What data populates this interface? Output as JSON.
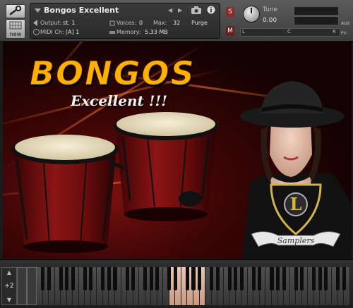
{
  "instrument": {
    "name": "Bongos Excellent",
    "output_label": "Output:",
    "output_value": "st. 1",
    "voices_label": "Voices:",
    "voices_value": "0",
    "max_label": "Max:",
    "max_value": "32",
    "purge_label": "Purge",
    "midi_label": "MIDI Ch:",
    "midi_value": "[A]  1",
    "memory_label": "Memory:",
    "memory_value": "5.33 MB"
  },
  "controls": {
    "solo_label": "S",
    "mute_label": "M",
    "tune_label": "Tune",
    "tune_value": "0.00",
    "aux_label": "AUX",
    "pv_label": "PV",
    "pan_left_label": "L",
    "pan_center_label": "C",
    "pan_right_label": "R"
  },
  "artwork": {
    "title": "BONGOS",
    "subtitle": "Excellent !!!",
    "logo_text": "Samplers",
    "logo_monogram": "L"
  },
  "keyboard": {
    "octave_value": "+2",
    "active_key_start": 22,
    "active_key_count": 6
  },
  "colors": {
    "title_orange": "#ffb000",
    "background_red": "#7a1010",
    "active_key": "#e0b8a0"
  }
}
